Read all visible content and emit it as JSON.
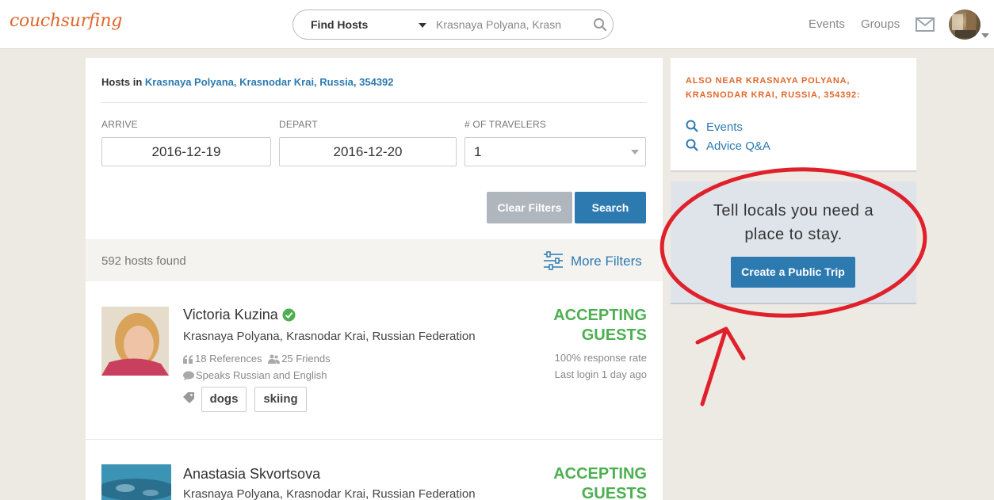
{
  "header": {
    "logo_text": "couchsurfing",
    "search_mode": "Find Hosts",
    "search_location": "Krasnaya Polyana, Krasn",
    "nav_events": "Events",
    "nav_groups": "Groups"
  },
  "main": {
    "hosts_in_prefix": "Hosts in ",
    "hosts_in_location": "Krasnaya Polyana, Krasnodar Krai, Russia, 354392",
    "filters": {
      "arrive_label": "ARRIVE",
      "arrive_value": "2016-12-19",
      "depart_label": "DEPART",
      "depart_value": "2016-12-20",
      "travelers_label": "# OF TRAVELERS",
      "travelers_value": "1"
    },
    "clear_filters_label": "Clear Filters",
    "search_label": "Search",
    "results_count": "592 hosts found",
    "more_filters_label": "More Filters",
    "hosts": [
      {
        "name": "Victoria Kuzina",
        "location": "Krasnaya Polyana, Krasnodar Krai, Russian Federation",
        "references": "18 References",
        "friends": "25 Friends",
        "languages": "Speaks Russian and English",
        "tags": [
          "dogs",
          "skiing"
        ],
        "status_line1": "ACCEPTING",
        "status_line2": "GUESTS",
        "response_rate": "100% response rate",
        "last_login": "Last login 1 day ago"
      },
      {
        "name": "Anastasia Skvortsova",
        "location": "Krasnaya Polyana, Krasnodar Krai, Russian Federation",
        "status_line1": "ACCEPTING",
        "status_line2": "GUESTS"
      }
    ]
  },
  "sidebar": {
    "also_near": "ALSO NEAR KRASNAYA POLYANA, KRASNODAR KRAI, RUSSIA, 354392:",
    "links": [
      "Events",
      "Advice Q&A"
    ],
    "tell_line1": "Tell locals you need a",
    "tell_line2": "place to stay.",
    "create_trip_label": "Create a Public Trip"
  },
  "colors": {
    "brand_orange": "#e0672d",
    "link_blue": "#2d7ab0",
    "accepting_green": "#4caf50",
    "annotation_red": "#e0202a"
  }
}
